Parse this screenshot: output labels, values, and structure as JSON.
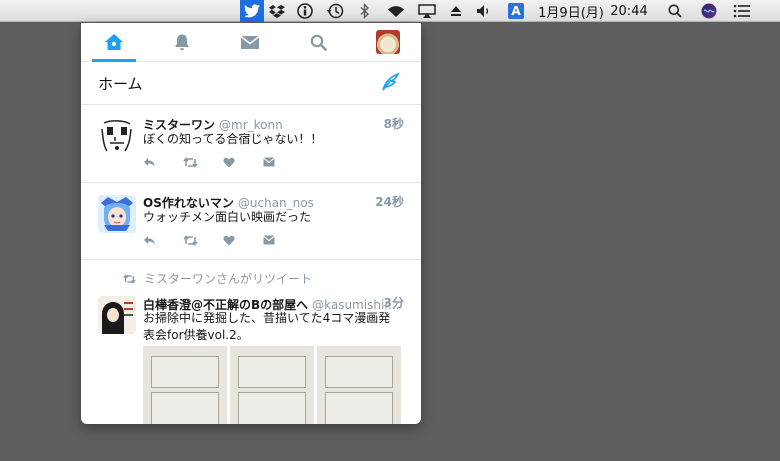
{
  "menubar": {
    "date": "1月9日(月)",
    "time": "20:44",
    "input_method": "A",
    "status_icons": [
      "twitter-icon",
      "dropbox-icon",
      "info-icon",
      "time-machine-icon",
      "bluetooth-icon",
      "wifi-icon",
      "airplay-icon",
      "eject-icon",
      "volume-icon",
      "input-method-icon",
      "spotlight-icon",
      "siri-icon",
      "notification-center-icon"
    ]
  },
  "tabs": [
    {
      "icon": "home-icon",
      "active": true
    },
    {
      "icon": "bell-icon",
      "active": false
    },
    {
      "icon": "mail-icon",
      "active": false
    },
    {
      "icon": "search-icon",
      "active": false
    },
    {
      "icon": "profile-avatar",
      "active": false
    }
  ],
  "home": {
    "title": "ホーム",
    "compose_icon": "compose-icon"
  },
  "accent_color": "#1da1f2",
  "tweets": [
    {
      "name": "ミスターワン",
      "handle": "@mr_konn",
      "time": "8秒",
      "text": "ぼくの知ってる合宿じゃない！！",
      "actions": [
        "reply-icon",
        "retweet-icon",
        "like-icon",
        "dm-icon"
      ]
    },
    {
      "name": "OS作れないマン",
      "handle": "@uchan_nos",
      "time": "24秒",
      "text": "ウォッチメン面白い映画だった",
      "actions": [
        "reply-icon",
        "retweet-icon",
        "like-icon",
        "dm-icon"
      ]
    },
    {
      "retweeted_by": "ミスターワンさんがリツイート",
      "name": "白樺香澄@不正解のBの部屋へ",
      "handle": "@kasumishir...",
      "time": "3分",
      "text": "お掃除中に発掘した、昔描いてた4コマ漫画発表会for供養vol.2。"
    }
  ]
}
